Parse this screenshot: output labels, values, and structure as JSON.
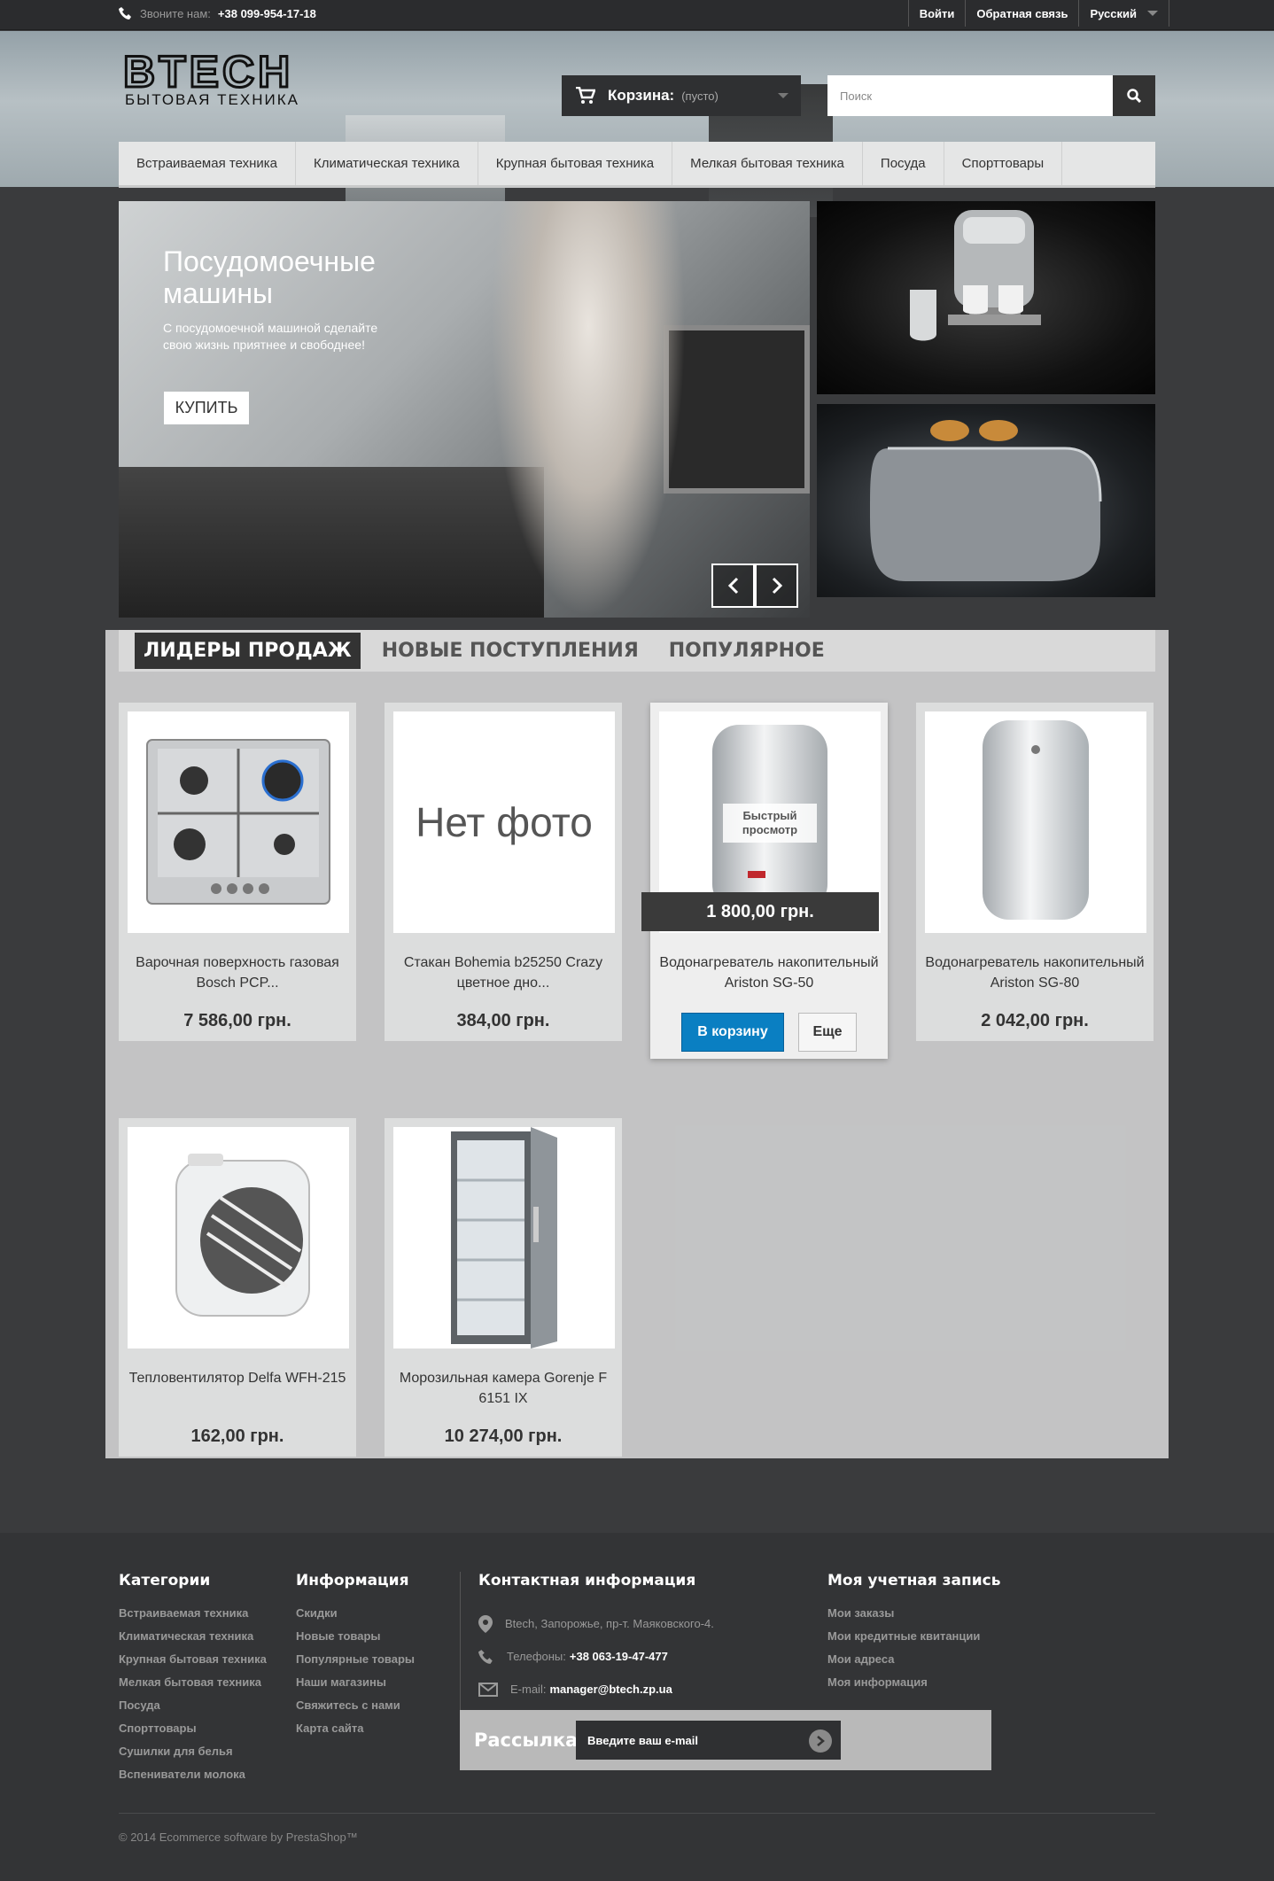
{
  "topbar": {
    "phone_label": "Звоните нам:",
    "phone_number": "+38 099-954-17-18",
    "login": "Войти",
    "feedback": "Обратная связь",
    "language": "Русский"
  },
  "header": {
    "logo_text": "BTECH",
    "logo_sub": "БЫТОВАЯ ТЕХНИКА",
    "cart_label": "Корзина:",
    "cart_status": "(пусто)",
    "search_placeholder": "Поиск"
  },
  "nav": [
    "Встраиваемая техника",
    "Климатическая техника",
    "Крупная бытовая техника",
    "Мелкая бытовая техника",
    "Посуда",
    "Спорттовары"
  ],
  "slider": {
    "title": "Посудомоечные машины",
    "text": "С посудомоечной машиной сделайте свою жизнь приятнее и свободнее!",
    "button": "КУПИТЬ"
  },
  "tabs": [
    "ЛИДЕРЫ ПРОДАЖ",
    "НОВЫЕ ПОСТУПЛЕНИЯ",
    "ПОПУЛЯРНОЕ"
  ],
  "products": [
    {
      "name": "Варочная поверхность газовая Bosch PCP...",
      "price": "7 586,00 грн.",
      "image": "gas-hob"
    },
    {
      "name": "Стакан Bohemia b25250 Crazy цветное дно...",
      "price": "384,00 грн.",
      "image": "no-photo",
      "no_photo_text": "Нет фото"
    },
    {
      "name": "Водонагреватель накопительный Ariston SG-50",
      "price": "1 800,00 грн.",
      "image": "water-heater",
      "quick_view": "Быстрый просмотр",
      "add_to_cart": "В корзину",
      "more": "Еще"
    },
    {
      "name": "Водонагреватель накопительный Ariston SG-80",
      "price": "2 042,00 грн.",
      "image": "water-heater"
    },
    {
      "name": "Тепловентилятор Delfa WFH-215",
      "price": "162,00 грн.",
      "image": "fan-heater"
    },
    {
      "name": "Морозильная камера Gorenje F 6151 IX",
      "price": "10 274,00 грн.",
      "image": "freezer"
    }
  ],
  "footer": {
    "categories": {
      "title": "Категории",
      "items": [
        "Встраиваемая техника",
        "Климатическая техника",
        "Крупная бытовая техника",
        "Мелкая бытовая техника",
        "Посуда",
        "Спорттовары",
        "Сушилки для белья",
        "Вспениватели молока"
      ]
    },
    "info": {
      "title": "Информация",
      "items": [
        "Скидки",
        "Новые товары",
        "Популярные товары",
        "Наши магазины",
        "Свяжитесь с нами",
        "Карта сайта"
      ]
    },
    "contact": {
      "title": "Контактная информация",
      "address": "Btech, Запорожье, пр-т. Маяковского-4.",
      "phone_label": "Телефоны:",
      "phone": "+38 063-19-47-477",
      "email_label": "E-mail:",
      "email": "manager@btech.zp.ua"
    },
    "account": {
      "title": "Моя учетная запись",
      "items": [
        "Мои заказы",
        "Мои кредитные квитанции",
        "Мои адреса",
        "Моя информация"
      ]
    },
    "newsletter": {
      "title": "Рассылка",
      "placeholder": "Введите ваш e-mail"
    },
    "copyright": "© 2014 Ecommerce software by PrestaShop™"
  },
  "colors": {
    "accent_blue": "#0a7fc2",
    "dark": "#333436"
  }
}
